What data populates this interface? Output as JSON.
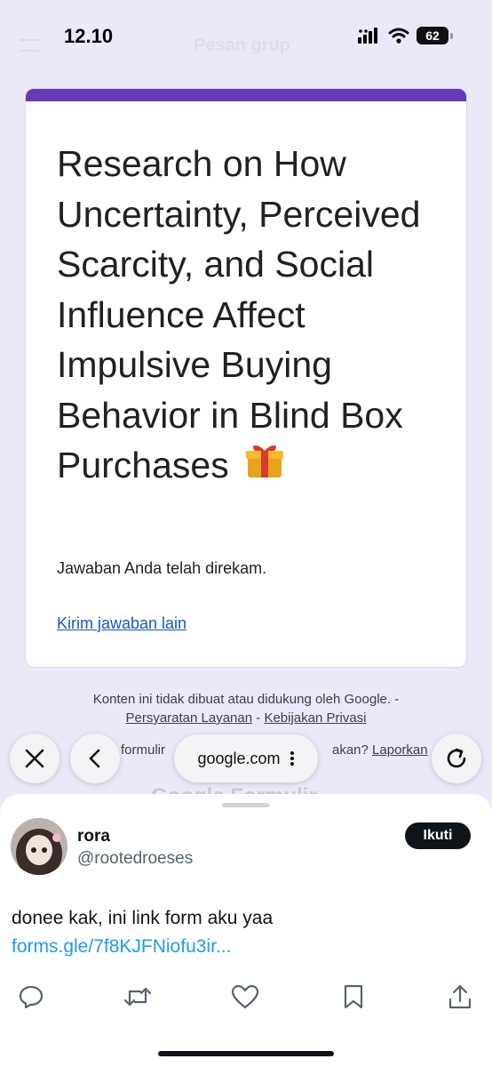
{
  "status_bar": {
    "time": "12.10",
    "battery": "62",
    "faded_title": "Pesan grup"
  },
  "form": {
    "title": "Research on How Uncertainty, Perceived Scarcity, and Social Influence Affect Impulsive Buying Behavior in Blind Box Purchases",
    "title_emoji_icon": "gift-icon",
    "confirmation": "Jawaban Anda telah direkam.",
    "another_response_link": "Kirim jawaban lain",
    "accent_color": "#673ab7"
  },
  "disclaimer": {
    "line1": "Konten ini tidak dibuat atau didukung oleh Google. -",
    "terms_link": "Persyaratan Layanan",
    "separator": "-",
    "privacy_link": "Kebijakan Privasi",
    "report_left_fragment": "formulir",
    "report_right_fragment": "akan?",
    "report_link": "Laporkan"
  },
  "browser": {
    "url": "google.com",
    "close_icon": "close-icon",
    "back_icon": "chevron-left-icon",
    "reload_icon": "reload-icon",
    "faded_footer": "Google Formulir"
  },
  "tweet": {
    "display_name": "rora",
    "handle": "@rootedroeses",
    "follow_label": "Ikuti",
    "text": "donee kak, ini link form aku yaa",
    "link": "forms.gle/7f8KJFNiofu3ir...",
    "link_color": "#1d9bf0",
    "actions": [
      "reply-icon",
      "retweet-icon",
      "like-icon",
      "bookmark-icon",
      "share-icon"
    ]
  }
}
